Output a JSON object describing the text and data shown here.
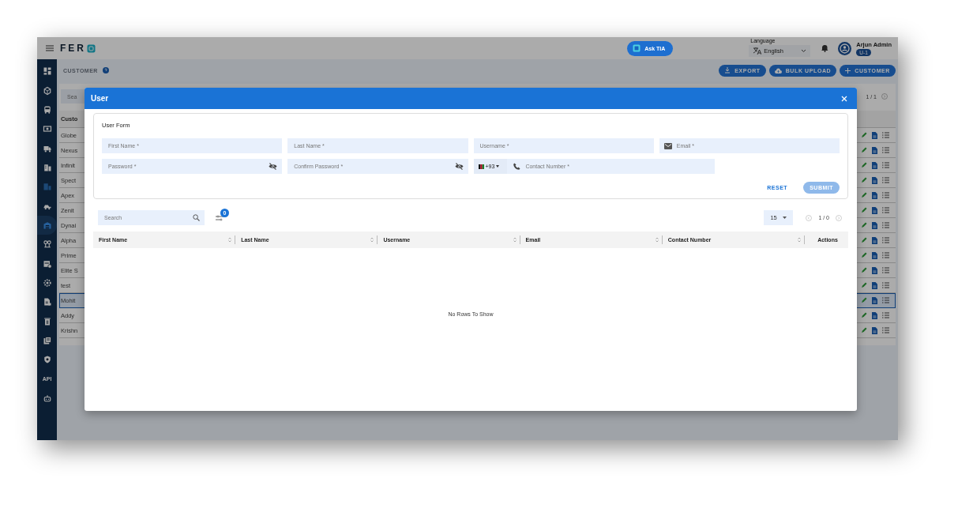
{
  "topbar": {
    "logo_text": "FER",
    "ask_button": "Ask TIA",
    "language": {
      "label": "Language",
      "value": "English"
    },
    "user": {
      "name": "Arjun Admin",
      "badge": "U-1"
    }
  },
  "sidebar": {
    "items": [
      {
        "selected": false
      },
      {
        "selected": false
      },
      {
        "selected": false
      },
      {
        "selected": false
      },
      {
        "selected": false
      },
      {
        "selected": false
      },
      {
        "selected": false
      },
      {
        "selected": false
      },
      {
        "selected": true
      },
      {
        "selected": false
      },
      {
        "selected": false
      },
      {
        "selected": false
      },
      {
        "selected": false
      },
      {
        "selected": false
      },
      {
        "selected": false
      },
      {
        "selected": false
      },
      {
        "label": "API",
        "selected": false
      },
      {
        "selected": false
      }
    ]
  },
  "page": {
    "title": "CUSTOMER",
    "actions": [
      {
        "kind": "download",
        "label": "EXPORT"
      },
      {
        "kind": "upload",
        "label": "BULK UPLOAD"
      },
      {
        "kind": "add",
        "label": "CUSTOMER"
      }
    ],
    "search_placeholder": "Sea",
    "column_1": "Custo",
    "pagination": "1 / 1",
    "rows": [
      {
        "name": "Globe",
        "selected": false
      },
      {
        "name": "Nexus",
        "selected": false
      },
      {
        "name": "Infinit",
        "selected": false
      },
      {
        "name": "Spect",
        "selected": false
      },
      {
        "name": "Apex",
        "selected": false
      },
      {
        "name": "Zenit",
        "selected": false
      },
      {
        "name": "Dynai",
        "selected": false
      },
      {
        "name": "Alpha",
        "selected": false
      },
      {
        "name": "Prime",
        "selected": false
      },
      {
        "name": "Elite S",
        "selected": false
      },
      {
        "name": "test",
        "selected": false
      },
      {
        "name": "Mohit",
        "selected": true
      },
      {
        "name": "Addy",
        "selected": false
      },
      {
        "name": "Krishn",
        "selected": false
      }
    ]
  },
  "dialog": {
    "title": "User",
    "form": {
      "title": "User Form",
      "rows": [
        [
          {
            "kind": "text",
            "placeholder": "First Name *"
          },
          {
            "kind": "text",
            "placeholder": "Last Name *"
          },
          {
            "kind": "text",
            "placeholder": "Username *"
          },
          {
            "kind": "email",
            "placeholder": "Email *"
          }
        ],
        [
          {
            "kind": "password",
            "placeholder": "Password *"
          },
          {
            "kind": "password",
            "placeholder": "Confirm Password *"
          },
          {
            "kind": "phone",
            "country_code": "+93",
            "placeholder": "Contact Number *"
          }
        ]
      ],
      "buttons": [
        {
          "kind": "text",
          "label": "RESET",
          "disabled": false
        },
        {
          "kind": "filled",
          "label": "SUBMIT",
          "disabled": true
        }
      ]
    },
    "grid": {
      "search_placeholder": "Search",
      "filter_count": "0",
      "page_size": "15",
      "page_info": "1 / 0",
      "columns": [
        "First Name",
        "Last Name",
        "Username",
        "Email",
        "Contact Number",
        "Actions"
      ],
      "empty_message": "No Rows To Show"
    }
  }
}
